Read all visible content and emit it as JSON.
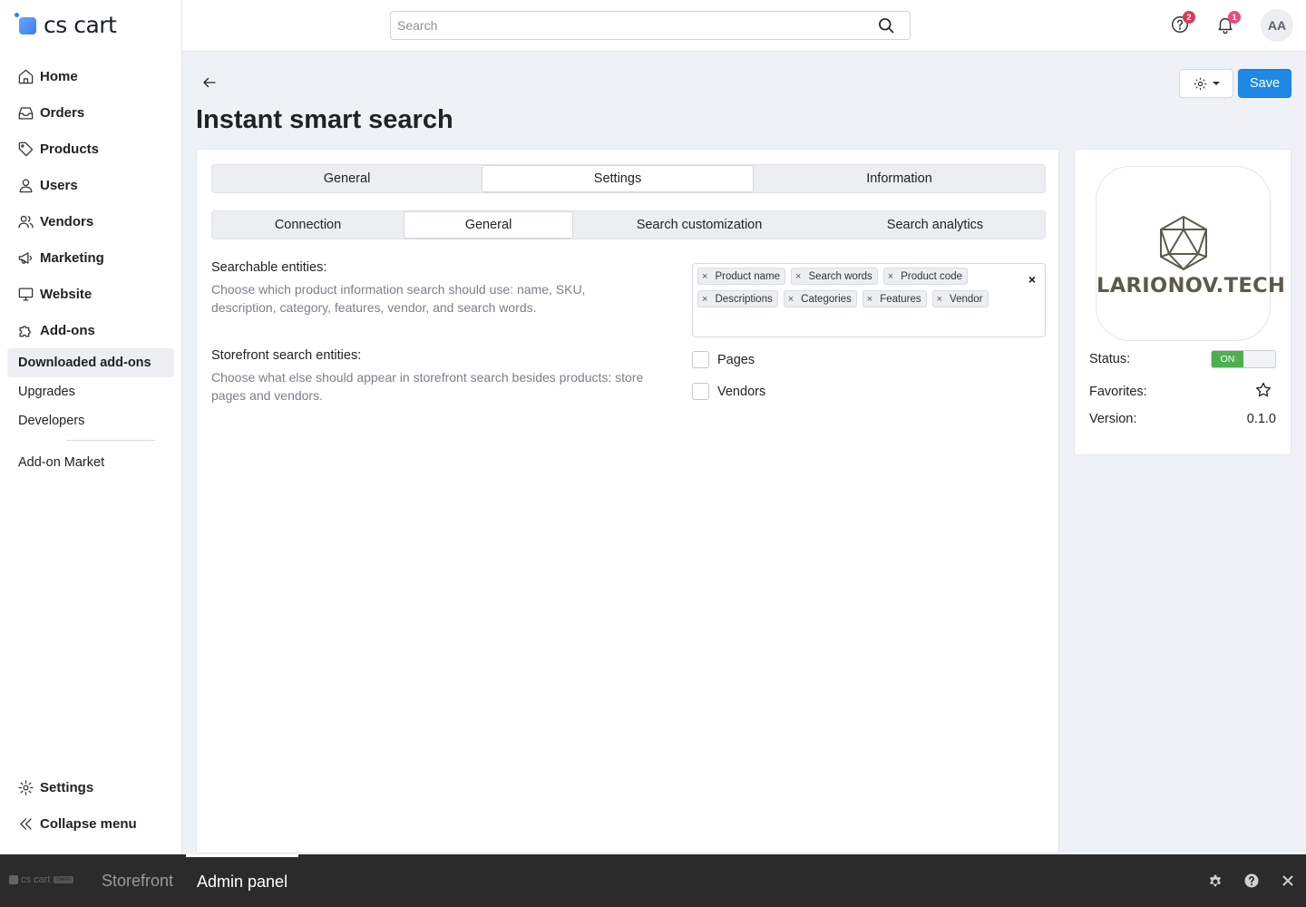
{
  "app": {
    "logo_text": "cs cart",
    "page_title": "Instant smart search"
  },
  "search": {
    "placeholder": "Search"
  },
  "topbar": {
    "help_badge": "2",
    "notifications_badge": "1",
    "avatar_initials": "AA"
  },
  "sidebar": {
    "items": [
      {
        "label": "Home",
        "icon": "home-icon"
      },
      {
        "label": "Orders",
        "icon": "inbox-icon"
      },
      {
        "label": "Products",
        "icon": "tag-icon"
      },
      {
        "label": "Users",
        "icon": "user-icon"
      },
      {
        "label": "Vendors",
        "icon": "users-icon"
      },
      {
        "label": "Marketing",
        "icon": "megaphone-icon"
      },
      {
        "label": "Website",
        "icon": "monitor-icon"
      },
      {
        "label": "Add-ons",
        "icon": "puzzle-icon"
      }
    ],
    "subitems": [
      "Downloaded add-ons",
      "Upgrades",
      "Developers",
      "Add-on Market"
    ],
    "active_subitem": "Downloaded add-ons",
    "bottom": [
      {
        "label": "Settings",
        "icon": "gear-icon"
      },
      {
        "label": "Collapse menu",
        "icon": "double-chevron-left-icon"
      }
    ]
  },
  "toolbar": {
    "save_label": "Save"
  },
  "tabs_primary": [
    "General",
    "Settings",
    "Information"
  ],
  "tabs_primary_active": "Settings",
  "tabs_secondary": [
    "Connection",
    "General",
    "Search customization",
    "Search analytics"
  ],
  "tabs_secondary_active": "General",
  "fields": {
    "searchable": {
      "label": "Searchable entities:",
      "description": "Choose which product information search should use: name, SKU, description, category, features, vendor, and search words.",
      "tags_row1": [
        "Product name",
        "Search words",
        "Product code"
      ],
      "tags_row2": [
        "Descriptions",
        "Categories",
        "Features",
        "Vendor"
      ],
      "tag_remove_glyph": "×",
      "clear_glyph": "×"
    },
    "storefront": {
      "label": "Storefront search entities:",
      "description": "Choose what else should appear in storefront search besides products: store pages and vendors.",
      "options": [
        {
          "label": "Pages",
          "checked": false
        },
        {
          "label": "Vendors",
          "checked": false
        }
      ]
    }
  },
  "addon_card": {
    "brand": "LARIONOV.TECH",
    "status_label": "Status:",
    "status_value": "ON",
    "favorites_label": "Favorites:",
    "version_label": "Version:",
    "version_value": "0.1.0"
  },
  "bottombar": {
    "logo_text": "cs cart",
    "demo_badge": "Demo",
    "tabs": [
      "Storefront",
      "Admin panel"
    ],
    "active_tab": "Admin panel"
  },
  "colors": {
    "primary": "#1e88e5",
    "status_on": "#4caf50",
    "badge_red": "#d93a55",
    "badge_pink": "#ea4c7d",
    "bottom_bar": "#2b2b2b"
  }
}
